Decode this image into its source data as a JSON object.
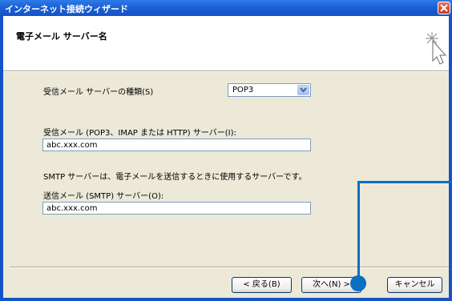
{
  "window": {
    "title": "インターネット接続ウィザード"
  },
  "header": {
    "title": "電子メール サーバー名"
  },
  "form": {
    "incoming_type_label": "受信メール サーバーの種類(S)",
    "incoming_type_value": "POP3",
    "incoming_server_label": "受信メール (POP3、IMAP または HTTP) サーバー(I):",
    "incoming_server_value": "abc.xxx.com",
    "smtp_note": "SMTP サーバーは、電子メールを送信するときに使用するサーバーです。",
    "outgoing_server_label": "送信メール (SMTP) サーバー(O):",
    "outgoing_server_value": "abc.xxx.com"
  },
  "buttons": {
    "back": "< 戻る(B)",
    "next": "次へ(N) >",
    "cancel": "キャンセル"
  },
  "colors": {
    "titlebar": "#1B61D6",
    "callout": "#0B6FC2",
    "dialog_bg": "#ECE9D8"
  },
  "icons": {
    "wizard": "wizard-cursor-icon",
    "close": "close-icon",
    "dropdown": "chevron-down-icon"
  }
}
